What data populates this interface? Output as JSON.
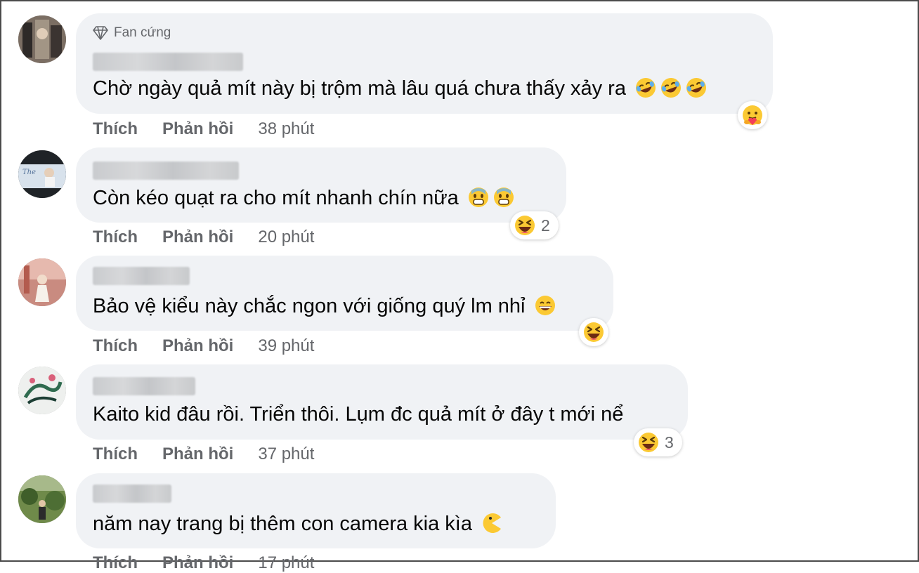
{
  "comments": [
    {
      "badge": "Fan cứng",
      "text": "Chờ ngày quả mít này bị trộm mà lâu quá chưa thấy xảy ra",
      "text_emojis": [
        "rolling-laughing-emoji",
        "rolling-laughing-emoji",
        "rolling-laughing-emoji"
      ],
      "actions": {
        "like": "Thích",
        "reply": "Phản hồi",
        "time": "38 phút"
      },
      "reaction": {
        "emoji": "care-emoji",
        "count": ""
      }
    },
    {
      "text": "Còn kéo quạt ra cho mít nhanh chín nữa",
      "text_emojis": [
        "cold-sweat-emoji",
        "cold-sweat-emoji"
      ],
      "actions": {
        "like": "Thích",
        "reply": "Phản hồi",
        "time": "20 phút"
      },
      "reaction": {
        "emoji": "haha-emoji",
        "count": "2"
      }
    },
    {
      "text": "Bảo vệ kiểu này chắc ngon với giống quý lm nhỉ",
      "text_emojis": [
        "grinning-emoji"
      ],
      "actions": {
        "like": "Thích",
        "reply": "Phản hồi",
        "time": "39 phút"
      },
      "reaction": {
        "emoji": "haha-emoji",
        "count": ""
      }
    },
    {
      "text": "Kaito kid đâu rồi. Triển thôi. Lụm đc quả mít ở đây t mới nể",
      "text_emojis": [],
      "actions": {
        "like": "Thích",
        "reply": "Phản hồi",
        "time": "37 phút"
      },
      "reaction": {
        "emoji": "haha-emoji",
        "count": "3"
      }
    },
    {
      "text": "năm nay trang bị thêm con camera kia kìa",
      "text_emojis": [
        "pacman-emoji"
      ],
      "actions": {
        "like": "Thích",
        "reply": "Phản hồi",
        "time": "17 phút"
      },
      "reaction": null
    }
  ],
  "colors": {
    "bubble": "#f0f2f5",
    "text": "#050505",
    "secondary": "#65676b",
    "emoji_yellow": "#fbc933"
  }
}
